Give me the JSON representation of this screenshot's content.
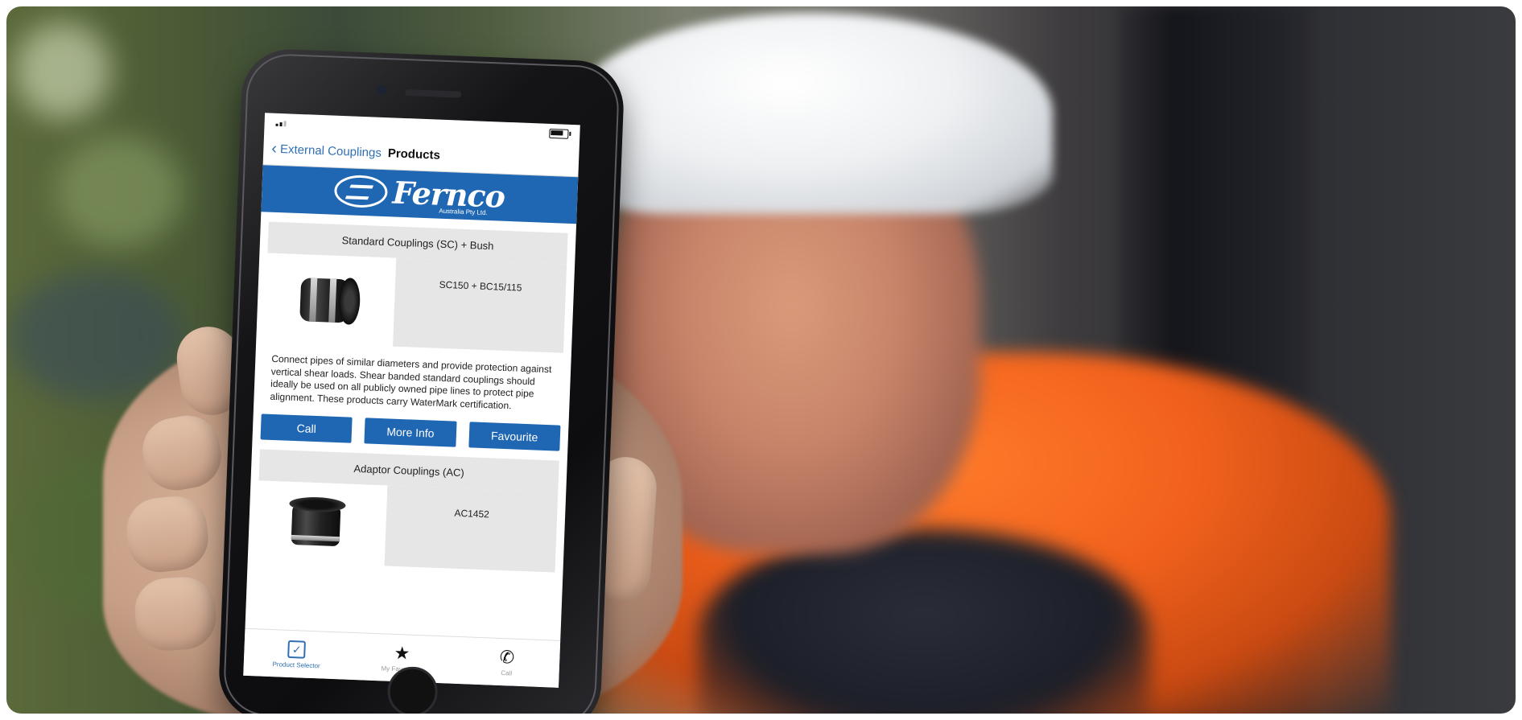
{
  "scene": {
    "colors": {
      "vest": "#f1611c",
      "hardhat": "#eef0f2",
      "brand_blue": "#1f66b3",
      "link_blue": "#2f6fb3"
    }
  },
  "app": {
    "status": {
      "battery_level": 0.7
    },
    "nav": {
      "back_label": "External Couplings",
      "title": "Products"
    },
    "logo": {
      "name": "Fernco",
      "subtitle": "Australia Pty Ltd."
    },
    "products": [
      {
        "section_title": "Standard Couplings (SC) + Bush",
        "code": "SC150 + BC15/115",
        "image_icon": "coupling-image",
        "description": "Connect pipes of similar diameters and provide protection against vertical shear loads. Shear banded standard couplings should ideally be used on all publicly owned pipe lines to protect pipe alignment. These products carry WaterMark certification.",
        "buttons": {
          "call": "Call",
          "more_info": "More Info",
          "favourite": "Favourite"
        }
      },
      {
        "section_title": "Adaptor Couplings (AC)",
        "code": "AC1452",
        "image_icon": "adaptor-coupling-image"
      }
    ],
    "tabs": [
      {
        "label": "Product Selector",
        "icon": "checkbox-icon",
        "active": true
      },
      {
        "label": "My Favourites",
        "icon": "star-icon",
        "active": false
      },
      {
        "label": "Call",
        "icon": "phone-icon",
        "active": false
      }
    ]
  }
}
